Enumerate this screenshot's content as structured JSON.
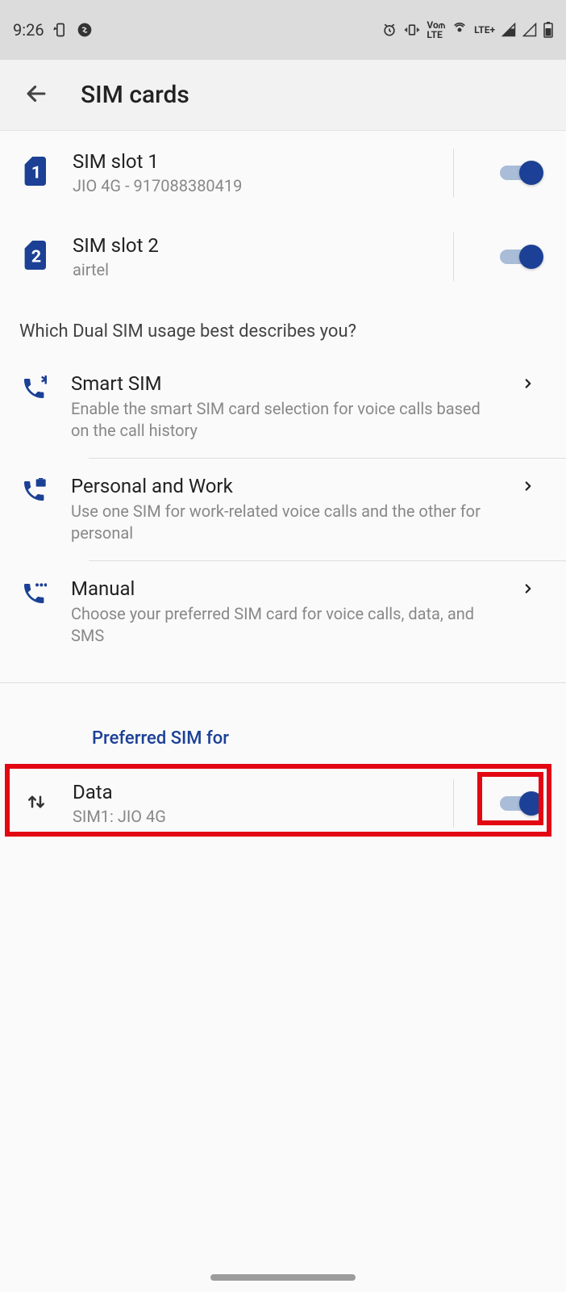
{
  "status": {
    "time": "9:26",
    "net_label": "LTE+"
  },
  "appbar": {
    "title": "SIM cards"
  },
  "sim_slots": [
    {
      "name": "SIM slot 1",
      "sub": "JIO 4G - 917088380419",
      "num": "1"
    },
    {
      "name": "SIM slot 2",
      "sub": "airtel",
      "num": "2"
    }
  ],
  "dual_sim_header": "Which Dual SIM usage best describes you?",
  "options": {
    "smart": {
      "title": "Smart SIM",
      "desc": "Enable the smart SIM card selection for voice calls based on the call history"
    },
    "personal": {
      "title": "Personal and Work",
      "desc": "Use one SIM for work-related voice calls and the other for personal"
    },
    "manual": {
      "title": "Manual",
      "desc": "Choose your preferred SIM card for voice calls, data, and SMS"
    }
  },
  "preferred": {
    "header": "Preferred SIM for",
    "data_title": "Data",
    "data_sub": "SIM1: JIO 4G"
  }
}
